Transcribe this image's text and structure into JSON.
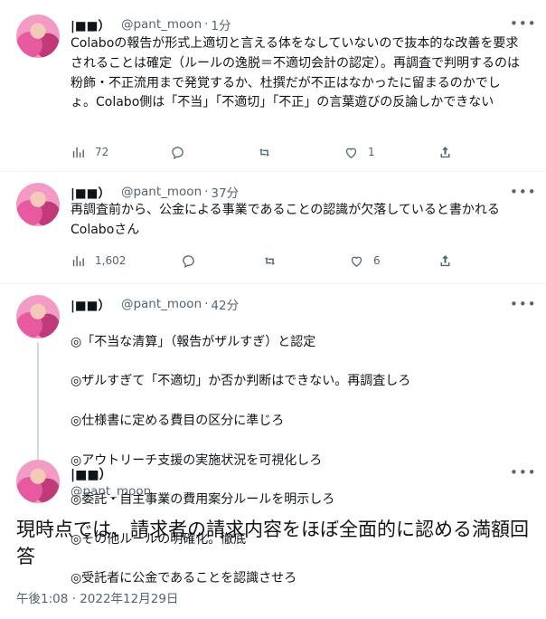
{
  "tweets": [
    {
      "name": "|■■）",
      "handle": "@pant_moon",
      "dot": "·",
      "time": "1分",
      "text": "Colaboの報告が形式上適切と言える体をなしていないので抜本的な改善を要求されることは確定（ルールの逸脱＝不適切会計の認定）。再調査で判明するのは粉飾・不正流用まで発覚するか、杜撰だが不正はなかったに留まるのかでしょ。Colabo側は「不当」「不適切」「不正」の言葉遊びの反論しかできない",
      "views": "72",
      "replies": "",
      "retweets": "",
      "likes": "1"
    },
    {
      "name": "|■■）",
      "handle": "@pant_moon",
      "dot": "·",
      "time": "37分",
      "text": "再調査前から、公金による事業であることの認識が欠落していると書かれるColaboさん",
      "views": "1,602",
      "replies": "",
      "retweets": "",
      "likes": "6"
    },
    {
      "name": "|■■）",
      "handle": "@pant_moon",
      "dot": "·",
      "time": "42分",
      "lines": [
        "◎「不当な清算」（報告がザルすぎ）と認定",
        "◎ザルすぎて「不適切」か否か判断はできない。再調査しろ",
        "◎仕様書に定める費目の区分に準じろ",
        "◎アウトリーチ支援の実施状況を可視化しろ",
        "◎委託・自主事業の費用案分ルールを明示しろ",
        "◎その他ルールの明確化。徹底",
        "◎受託者に公金であることを認識させろ"
      ]
    }
  ],
  "main_tweet": {
    "name": "|■■）",
    "handle": "@pant_moon",
    "text": "現時点では、請求者の請求内容をほぼ全面的に認める満額回答",
    "timestamp": "午後1:08 · 2022年12月29日"
  },
  "icons": {
    "more": "more-horizontal-icon",
    "views": "views-chart-icon",
    "reply": "reply-bubble-icon",
    "retweet": "retweet-icon",
    "like": "heart-icon",
    "share": "share-icon"
  },
  "colors": {
    "text": "#0f1419",
    "secondary": "#536471",
    "thread_line": "#cfd9de",
    "divider": "#eff3f4"
  }
}
